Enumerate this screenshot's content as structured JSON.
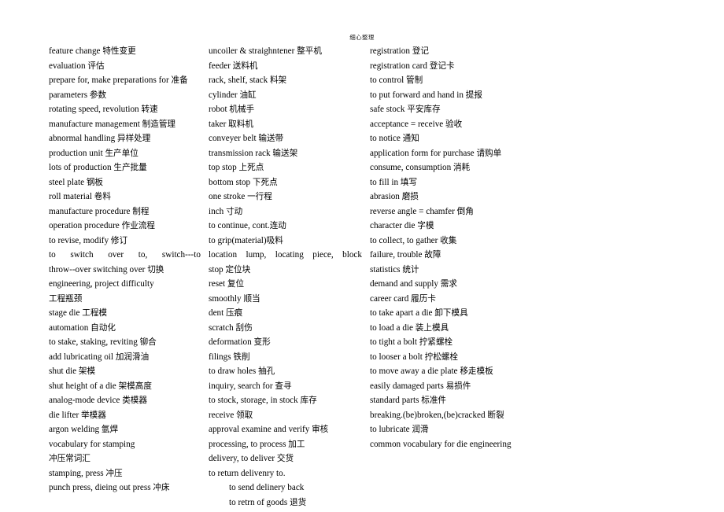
{
  "document": {
    "header": "细心整理",
    "columns": [
      {
        "id": "column-1",
        "entries": [
          {
            "text": "feature change  特性变更",
            "style": "normal"
          },
          {
            "text": "evaluation 评估",
            "style": "normal"
          },
          {
            "text": "prepare for, make preparations for 准备",
            "style": "justify-top"
          },
          {
            "text": "parameters 参数",
            "style": "normal"
          },
          {
            "text": "rotating speed, revolution 转速",
            "style": "normal"
          },
          {
            "text": "manufacture management 制造管理",
            "style": "normal"
          },
          {
            "text": "abnormal handling 异样处理",
            "style": "normal"
          },
          {
            "text": "production unit 生产单位",
            "style": "normal"
          },
          {
            "text": "lots of production 生产批量",
            "style": "normal"
          },
          {
            "text": "steel plate 钢板",
            "style": "normal"
          },
          {
            "text": "roll material 卷料",
            "style": "normal"
          },
          {
            "text": "manufacture procedure 制程",
            "style": "normal"
          },
          {
            "text": "operation procedure 作业流程",
            "style": "normal"
          },
          {
            "text": "to revise, modify 修订",
            "style": "normal"
          },
          {
            "text": "to switch over to, switch---to",
            "style": "justify"
          },
          {
            "text": "throw--over switching over 切换",
            "style": "normal"
          },
          {
            "text": "engineering, project difficulty",
            "style": "normal"
          },
          {
            "text": "工程瓶颈",
            "style": "normal"
          },
          {
            "text": "stage die 工程模",
            "style": "normal"
          },
          {
            "text": "automation 自动化",
            "style": "normal"
          },
          {
            "text": "to stake, staking, reviting 铆合",
            "style": "normal"
          },
          {
            "text": "add lubricating oil 加润滑油",
            "style": "normal"
          },
          {
            "text": "shut die 架模",
            "style": "normal"
          },
          {
            "text": "shut height of a die 架模高度",
            "style": "normal"
          },
          {
            "text": "analog-mode device 类模器",
            "style": "normal"
          },
          {
            "text": "die lifter 举模器",
            "style": "normal"
          },
          {
            "text": "argon welding 氩焊",
            "style": "normal"
          },
          {
            "text": "vocabulary for stamping",
            "style": "normal"
          },
          {
            "text": "冲压常词汇",
            "style": "normal"
          },
          {
            "text": "stamping, press 冲压",
            "style": "normal"
          },
          {
            "text": "punch press, dieing out press 冲床",
            "style": "normal"
          }
        ]
      },
      {
        "id": "column-2",
        "entries": [
          {
            "text": "uncoiler & straighntener 整平机",
            "style": "normal"
          },
          {
            "text": "feeder 送料机",
            "style": "normal"
          },
          {
            "text": "rack, shelf, stack 料架",
            "style": "normal"
          },
          {
            "text": "cylinder 油缸",
            "style": "normal"
          },
          {
            "text": "robot 机械手",
            "style": "normal"
          },
          {
            "text": "taker 取料机",
            "style": "normal"
          },
          {
            "text": "conveyer belt 输送带",
            "style": "normal"
          },
          {
            "text": "transmission rack 输送架",
            "style": "normal"
          },
          {
            "text": "top stop 上死点",
            "style": "normal"
          },
          {
            "text": "bottom stop 下死点",
            "style": "normal"
          },
          {
            "text": "one stroke 一行程",
            "style": "normal"
          },
          {
            "text": "inch 寸动",
            "style": "normal"
          },
          {
            "text": "to continue, cont.连动",
            "style": "normal"
          },
          {
            "text": "to grip(material)吸料",
            "style": "normal"
          },
          {
            "text": "location lump, locating piece, block",
            "style": "justify"
          },
          {
            "text": "stop 定位块",
            "style": "normal"
          },
          {
            "text": "reset 复位",
            "style": "normal"
          },
          {
            "text": "smoothly 顺当",
            "style": "normal"
          },
          {
            "text": "dent 压痕",
            "style": "normal"
          },
          {
            "text": "scratch 刮伤",
            "style": "normal"
          },
          {
            "text": "deformation 变形",
            "style": "normal"
          },
          {
            "text": "filings 铁削",
            "style": "normal"
          },
          {
            "text": "to draw holes 抽孔",
            "style": "normal"
          },
          {
            "text": "inquiry, search for 查寻",
            "style": "normal"
          },
          {
            "text": "to stock, storage, in stock 库存",
            "style": "normal"
          },
          {
            "text": "receive 领取",
            "style": "normal"
          },
          {
            "text": "approval examine and verify 审核",
            "style": "normal"
          },
          {
            "text": "processing, to process 加工",
            "style": "normal"
          },
          {
            "text": "delivery, to deliver  交货",
            "style": "normal"
          },
          {
            "text": "to return delivenry to.",
            "style": "normal"
          },
          {
            "text": "to send delinery back",
            "style": "indent"
          },
          {
            "text": "to retrn of goods 退货",
            "style": "indent"
          }
        ]
      },
      {
        "id": "column-3",
        "entries": [
          {
            "text": "registration 登记",
            "style": "normal"
          },
          {
            "text": "registration card 登记卡",
            "style": "normal"
          },
          {
            "text": "to control 管制",
            "style": "normal"
          },
          {
            "text": "to put forward and hand in 提报",
            "style": "normal"
          },
          {
            "text": "safe stock 平安库存",
            "style": "normal"
          },
          {
            "text": "acceptance = receive 验收",
            "style": "normal"
          },
          {
            "text": "to notice 通知",
            "style": "normal"
          },
          {
            "text": "application form for purchase 请购单",
            "style": "normal"
          },
          {
            "text": "consume, consumption 消耗",
            "style": "normal"
          },
          {
            "text": "to fill in 填写",
            "style": "normal"
          },
          {
            "text": "abrasion 磨损",
            "style": "normal"
          },
          {
            "text": "reverse angle = chamfer 倒角",
            "style": "normal"
          },
          {
            "text": "character die 字模",
            "style": "normal"
          },
          {
            "text": "to collect, to gather 收集",
            "style": "normal"
          },
          {
            "text": "failure, trouble 故障",
            "style": "normal"
          },
          {
            "text": "statistics 统计",
            "style": "normal"
          },
          {
            "text": "demand and supply 需求",
            "style": "normal"
          },
          {
            "text": "career card 履历卡",
            "style": "normal"
          },
          {
            "text": "to take apart a die 卸下模具",
            "style": "normal"
          },
          {
            "text": "to load a die 装上模具",
            "style": "normal"
          },
          {
            "text": "to tight a bolt 拧紧螺栓",
            "style": "normal"
          },
          {
            "text": "to looser a bolt 拧松螺栓",
            "style": "normal"
          },
          {
            "text": "to move away a die plate 移走模板",
            "style": "normal"
          },
          {
            "text": "easily damaged parts 易损件",
            "style": "normal"
          },
          {
            "text": "standard parts 标准件",
            "style": "normal"
          },
          {
            "text": "breaking.(be)broken,(be)cracked 断裂",
            "style": "normal"
          },
          {
            "text": "to lubricate 润滑",
            "style": "normal"
          },
          {
            "text": "common vocabulary for die engineering",
            "style": "justify-top"
          }
        ]
      }
    ]
  }
}
